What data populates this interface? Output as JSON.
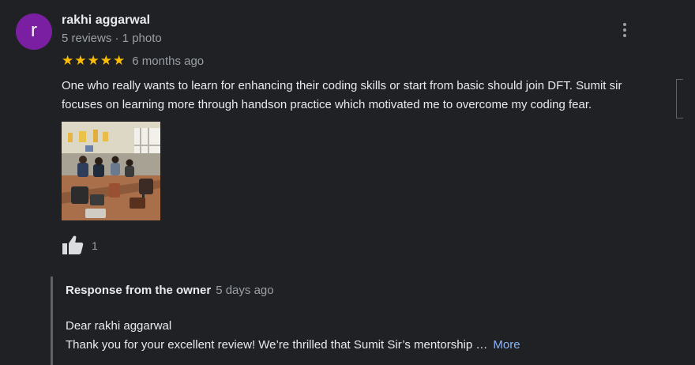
{
  "review": {
    "author_initial": "r",
    "author_name": "rakhi aggarwal",
    "author_meta": "5 reviews · 1 photo",
    "rating": 5,
    "stars": [
      "★",
      "★",
      "★",
      "★",
      "★"
    ],
    "time": "6 months ago",
    "text": "One who really wants to learn for enhancing their coding skills or start from basic should join DFT. Sumit sir focuses on learning more through handson practice which motivated me to overcome my coding fear.",
    "like_count": "1"
  },
  "response": {
    "title": "Response from the owner",
    "time": "5 days ago",
    "greeting": "Dear rakhi aggarwal",
    "body": "Thank you for your excellent review! We’re thrilled that Sumit Sir’s mentorship …",
    "more_label": "More"
  },
  "colors": {
    "background": "#202124",
    "avatar": "#7b1fa2",
    "star": "#fbbc04",
    "link": "#8ab4f8",
    "secondary_text": "#9aa0a6"
  },
  "icons": {
    "more_options": "more-vertical-icon",
    "like": "thumbs-up-icon",
    "star": "star-icon"
  }
}
